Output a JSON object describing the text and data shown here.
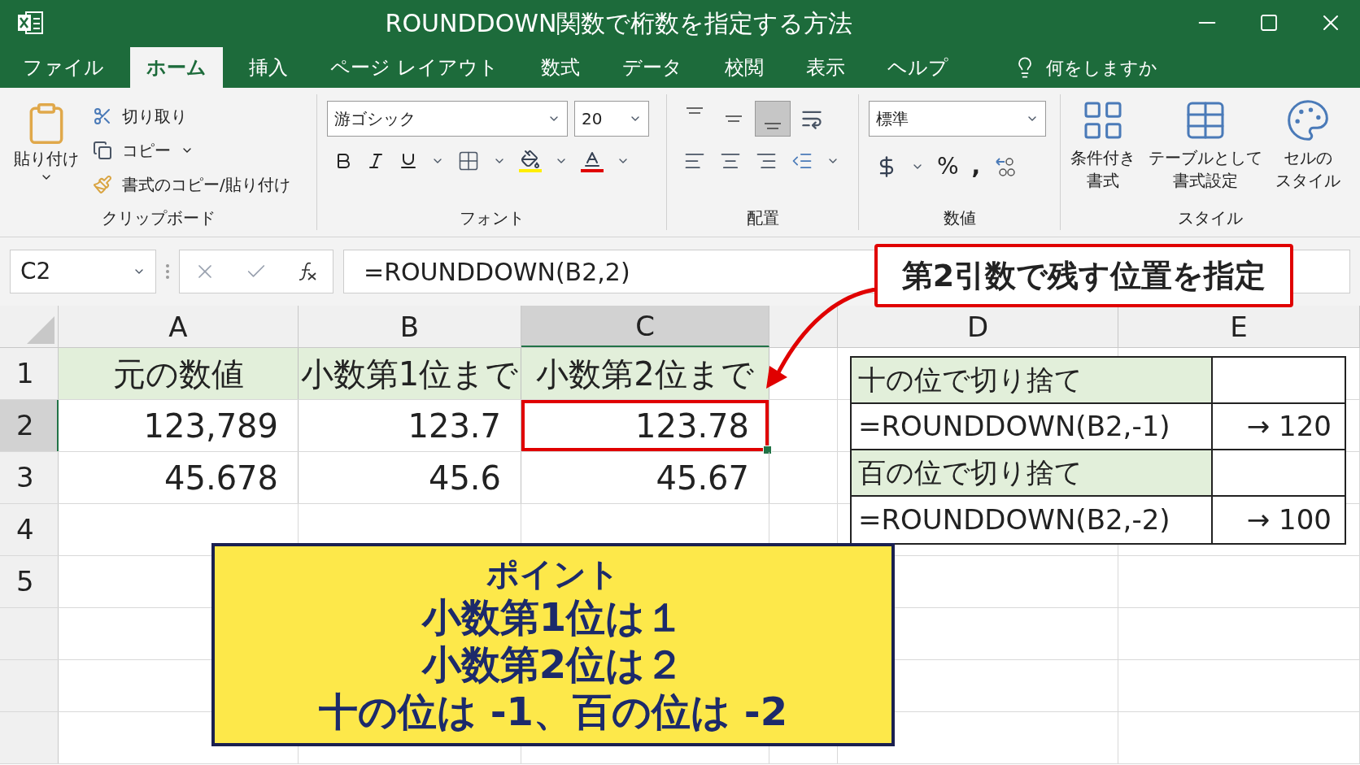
{
  "window": {
    "title": "ROUNDDOWN関数で桁数を指定する方法"
  },
  "ribbon_tabs": [
    {
      "label": "ファイル",
      "selected": false
    },
    {
      "label": "ホーム",
      "selected": true
    },
    {
      "label": "挿入",
      "selected": false
    },
    {
      "label": "ページ レイアウト",
      "selected": false
    },
    {
      "label": "数式",
      "selected": false
    },
    {
      "label": "データ",
      "selected": false
    },
    {
      "label": "校閲",
      "selected": false
    },
    {
      "label": "表示",
      "selected": false
    },
    {
      "label": "ヘルプ",
      "selected": false
    }
  ],
  "tell_me": "何をしますか",
  "clipboard": {
    "paste": "貼り付け",
    "cut": "切り取り",
    "copy": "コピー",
    "format_painter": "書式のコピー/貼り付け",
    "group": "クリップボード"
  },
  "font": {
    "name": "游ゴシック",
    "size": "20",
    "group": "フォント"
  },
  "alignment": {
    "group": "配置",
    "vertical": [
      {
        "kind": "top",
        "pressed": false
      },
      {
        "kind": "middle",
        "pressed": false
      },
      {
        "kind": "bottom",
        "pressed": true
      }
    ]
  },
  "number": {
    "format": "標準",
    "percent": "%",
    "comma": ",",
    "group": "数値"
  },
  "styles": {
    "buttons": [
      {
        "lines": [
          "条件付き",
          "書式"
        ]
      },
      {
        "lines": [
          "テーブルとして",
          "書式設定"
        ]
      },
      {
        "lines": [
          "セルの",
          "スタイル"
        ]
      }
    ],
    "group": "スタイル"
  },
  "formula_bar": {
    "name_box": "C2",
    "formula": "=ROUNDDOWN(B2,2)"
  },
  "sheet": {
    "columns": [
      {
        "label": "A",
        "selected": false
      },
      {
        "label": "B",
        "selected": false
      },
      {
        "label": "C",
        "selected": true
      },
      {
        "label": "D",
        "selected": false
      },
      {
        "label": "E",
        "selected": false
      }
    ],
    "row_headers": [
      {
        "label": "1",
        "selected": false
      },
      {
        "label": "2",
        "selected": true
      },
      {
        "label": "3",
        "selected": false
      },
      {
        "label": "4",
        "selected": false
      },
      {
        "label": "5",
        "selected": false
      }
    ],
    "rows": [
      [
        {
          "text": "元の数値",
          "kind": "header",
          "selected": false
        },
        {
          "text": "小数第1位まで",
          "kind": "header",
          "selected": false
        },
        {
          "text": "小数第2位まで",
          "kind": "header",
          "selected": false
        }
      ],
      [
        {
          "text": "123,789",
          "kind": "value",
          "selected": false
        },
        {
          "text": "123.7",
          "kind": "value",
          "selected": false
        },
        {
          "text": "123.78",
          "kind": "value",
          "selected": true
        }
      ],
      [
        {
          "text": "45.678",
          "kind": "value",
          "selected": false
        },
        {
          "text": "45.6",
          "kind": "value",
          "selected": false
        },
        {
          "text": "45.67",
          "kind": "value",
          "selected": false
        }
      ]
    ]
  },
  "side_table": [
    {
      "note": "十の位で切り捨て",
      "formula": "=ROUNDDOWN(B2,-1)",
      "result": "→ 120"
    },
    {
      "note": "百の位で切り捨て",
      "formula": "=ROUNDDOWN(B2,-2)",
      "result": "→ 100"
    }
  ],
  "callout": "第2引数で残す位置を指定",
  "point_box": {
    "title": "ポイント",
    "lines": [
      "小数第1位は１",
      "小数第2位は２",
      "十の位は -1、百の位は -2"
    ]
  }
}
